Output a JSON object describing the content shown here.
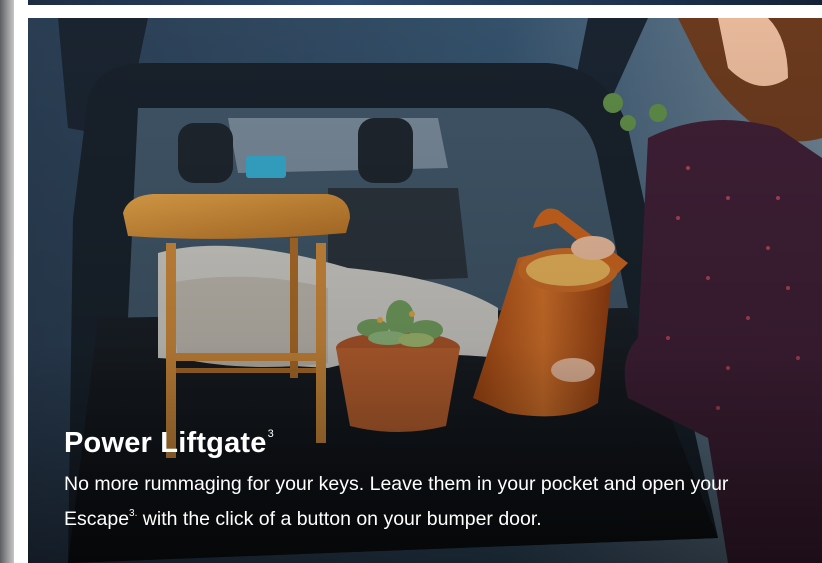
{
  "feature": {
    "title": "Power Liftgate",
    "title_footnote": "3",
    "body_part1": "No more rummaging for your keys. Leave them in your pocket and open your Escape",
    "body_footnote": "3.",
    "body_part2": " with the click of a button on your bumper door."
  },
  "colors": {
    "caption_text": "#ffffff",
    "accent_orange": "#c8631f"
  }
}
